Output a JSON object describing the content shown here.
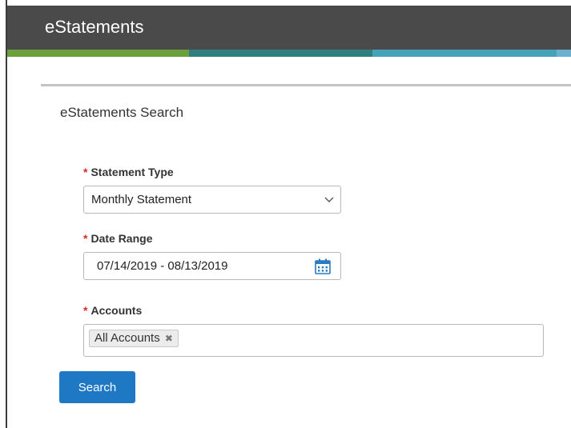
{
  "header": {
    "title": "eStatements"
  },
  "panel": {
    "title": "eStatements Search"
  },
  "form": {
    "required_marker": "*",
    "statement_type": {
      "label": "Statement Type",
      "value": "Monthly Statement",
      "icon": "chevron-down-icon"
    },
    "date_range": {
      "label": "Date Range",
      "value": "07/14/2019 - 08/13/2019",
      "icon": "calendar-icon"
    },
    "accounts": {
      "label": "Accounts",
      "tags": [
        {
          "label": "All Accounts",
          "remove_glyph": "✖"
        }
      ]
    },
    "search_label": "Search"
  },
  "colors": {
    "header_bg": "#4a4a4a",
    "stripe": [
      "#6aa13c",
      "#2f7f81",
      "#44a3b6",
      "#6bb0cf"
    ],
    "required": "#d62a2a",
    "button_bg": "#1f78c4",
    "icon_blue": "#2a7bc0"
  }
}
